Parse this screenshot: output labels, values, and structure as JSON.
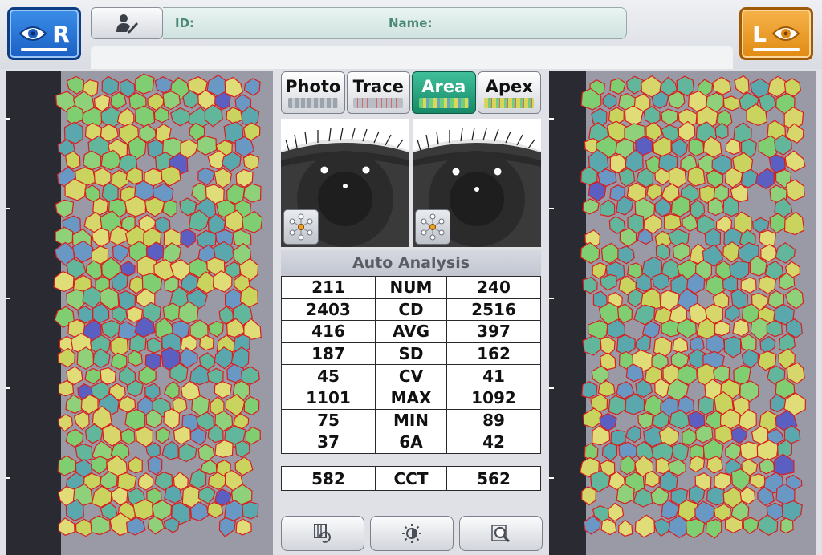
{
  "header": {
    "right_eye_label": "R",
    "left_eye_label": "L",
    "id_label": "ID:",
    "name_label": "Name:"
  },
  "mode_tabs": [
    {
      "label": "Photo",
      "active": false
    },
    {
      "label": "Trace",
      "active": false
    },
    {
      "label": "Area",
      "active": true
    },
    {
      "label": "Apex",
      "active": false
    }
  ],
  "analysis": {
    "title": "Auto Analysis",
    "rows": [
      {
        "right": "211",
        "metric": "NUM",
        "left": "240"
      },
      {
        "right": "2403",
        "metric": "CD",
        "left": "2516"
      },
      {
        "right": "416",
        "metric": "AVG",
        "left": "397"
      },
      {
        "right": "187",
        "metric": "SD",
        "left": "162"
      },
      {
        "right": "45",
        "metric": "CV",
        "left": "41"
      },
      {
        "right": "1101",
        "metric": "MAX",
        "left": "1092"
      },
      {
        "right": "75",
        "metric": "MIN",
        "left": "89"
      },
      {
        "right": "37",
        "metric": "6A",
        "left": "42"
      }
    ],
    "cct": {
      "right": "582",
      "metric": "CCT",
      "left": "562"
    }
  },
  "colors": {
    "right_accent": "#1b5fc4",
    "left_accent": "#e08a12",
    "active_tab": "#178a68",
    "cell_border": "#d81e1e"
  },
  "icons": {
    "right_eye": "eye-icon",
    "left_eye": "eye-icon",
    "patient": "patient-edit-icon",
    "fixation": "fixation-target-icon",
    "history": "history-icon",
    "brightness": "brightness-icon",
    "zoom": "zoom-icon"
  }
}
